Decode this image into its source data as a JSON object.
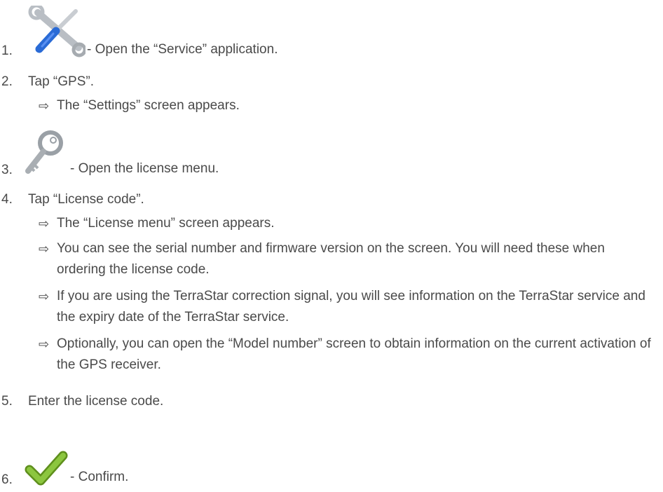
{
  "steps": [
    {
      "num": "1.",
      "icon": "wrench-screwdriver-icon",
      "text": "- Open the “Service” application."
    },
    {
      "num": "2.",
      "text": "Tap “GPS”.",
      "results": [
        "The “Settings” screen appears."
      ]
    },
    {
      "num": "3.",
      "icon": "key-icon",
      "text": "- Open the license menu."
    },
    {
      "num": "4.",
      "text": "Tap “License code”.",
      "results": [
        "The “License menu” screen appears.",
        "You can see the serial number and firmware version on the screen. You will need these when ordering the license code.",
        "If you are using the TerraStar correction signal, you will see information on the TerraStar service and the expiry date of the TerraStar service.",
        "Optionally, you can open the “Model number” screen to obtain information on the current activation of the GPS receiver."
      ]
    },
    {
      "num": "5.",
      "text": "Enter the license code."
    },
    {
      "num": "6.",
      "icon": "checkmark-icon",
      "text": "- Confirm."
    }
  ],
  "result_arrow": "⇨",
  "colors": {
    "text": "#4a4a4a",
    "check": "#7db22a",
    "tool": "#2a6bd6",
    "metal": "#b9bec4"
  }
}
